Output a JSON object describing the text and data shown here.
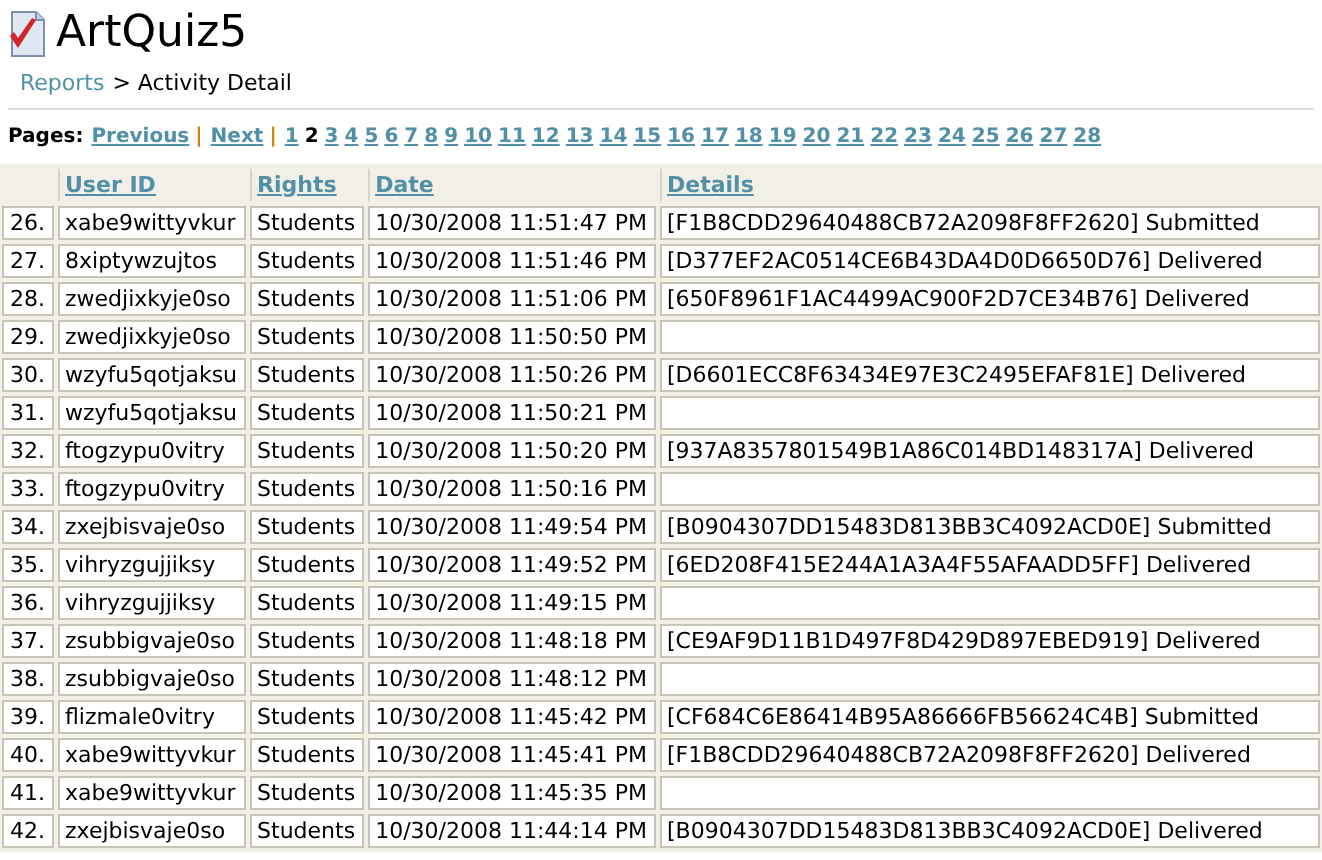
{
  "header": {
    "title": "ArtQuiz5",
    "breadcrumb": {
      "link": "Reports",
      "current": "> Activity Detail"
    }
  },
  "pager": {
    "label": "Pages:",
    "previous": "Previous",
    "next": "Next",
    "separator": "|",
    "pages": [
      {
        "label": "1",
        "selected": false
      },
      {
        "label": "2",
        "selected": true
      },
      {
        "label": "3",
        "selected": false
      },
      {
        "label": "4",
        "selected": false
      },
      {
        "label": "5",
        "selected": false
      },
      {
        "label": "6",
        "selected": false
      },
      {
        "label": "7",
        "selected": false
      },
      {
        "label": "8",
        "selected": false
      },
      {
        "label": "9",
        "selected": false
      },
      {
        "label": "10",
        "selected": false
      },
      {
        "label": "11",
        "selected": false
      },
      {
        "label": "12",
        "selected": false
      },
      {
        "label": "13",
        "selected": false
      },
      {
        "label": "14",
        "selected": false
      },
      {
        "label": "15",
        "selected": false
      },
      {
        "label": "16",
        "selected": false
      },
      {
        "label": "17",
        "selected": false
      },
      {
        "label": "18",
        "selected": false
      },
      {
        "label": "19",
        "selected": false
      },
      {
        "label": "20",
        "selected": false
      },
      {
        "label": "21",
        "selected": false
      },
      {
        "label": "22",
        "selected": false
      },
      {
        "label": "23",
        "selected": false
      },
      {
        "label": "24",
        "selected": false
      },
      {
        "label": "25",
        "selected": false
      },
      {
        "label": "26",
        "selected": false
      },
      {
        "label": "27",
        "selected": false
      },
      {
        "label": "28",
        "selected": false
      }
    ]
  },
  "table": {
    "columns": [
      "User ID",
      "Rights",
      "Date",
      "Details"
    ],
    "rows": [
      {
        "number": "26.",
        "user_id": "xabe9wittyvkur",
        "rights": "Students",
        "date": "10/30/2008 11:51:47 PM",
        "details": "[F1B8CDD29640488CB72A2098F8FF2620] Submitted"
      },
      {
        "number": "27.",
        "user_id": "8xiptywzujtos",
        "rights": "Students",
        "date": "10/30/2008 11:51:46 PM",
        "details": "[D377EF2AC0514CE6B43DA4D0D6650D76] Delivered"
      },
      {
        "number": "28.",
        "user_id": "zwedjixkyje0so",
        "rights": "Students",
        "date": "10/30/2008 11:51:06 PM",
        "details": "[650F8961F1AC4499AC900F2D7CE34B76] Delivered"
      },
      {
        "number": "29.",
        "user_id": "zwedjixkyje0so",
        "rights": "Students",
        "date": "10/30/2008 11:50:50 PM"
      },
      {
        "number": "30.",
        "user_id": "wzyfu5qotjaksu",
        "rights": "Students",
        "date": "10/30/2008 11:50:26 PM",
        "details": "[D6601ECC8F63434E97E3C2495EFAF81E] Delivered"
      },
      {
        "number": "31.",
        "user_id": "wzyfu5qotjaksu",
        "rights": "Students",
        "date": "10/30/2008 11:50:21 PM"
      },
      {
        "number": "32.",
        "user_id": "ftogzypu0vitry",
        "rights": "Students",
        "date": "10/30/2008 11:50:20 PM",
        "details": "[937A8357801549B1A86C014BD148317A] Delivered"
      },
      {
        "number": "33.",
        "user_id": "ftogzypu0vitry",
        "rights": "Students",
        "date": "10/30/2008 11:50:16 PM"
      },
      {
        "number": "34.",
        "user_id": "zxejbisvaje0so",
        "rights": "Students",
        "date": "10/30/2008 11:49:54 PM",
        "details": "[B0904307DD15483D813BB3C4092ACD0E] Submitted"
      },
      {
        "number": "35.",
        "user_id": "vihryzgujjiksy",
        "rights": "Students",
        "date": "10/30/2008 11:49:52 PM",
        "details": "[6ED208F415E244A1A3A4F55AFAADD5FF] Delivered"
      },
      {
        "number": "36.",
        "user_id": "vihryzgujjiksy",
        "rights": "Students",
        "date": "10/30/2008 11:49:15 PM"
      },
      {
        "number": "37.",
        "user_id": "zsubbigvaje0so",
        "rights": "Students",
        "date": "10/30/2008 11:48:18 PM",
        "details": "[CE9AF9D11B1D497F8D429D897EBED919] Delivered"
      },
      {
        "number": "38.",
        "user_id": "zsubbigvaje0so",
        "rights": "Students",
        "date": "10/30/2008 11:48:12 PM"
      },
      {
        "number": "39.",
        "user_id": "flizmale0vitry",
        "rights": "Students",
        "date": "10/30/2008 11:45:42 PM",
        "details": "[CF684C6E86414B95A86666FB56624C4B] Submitted"
      },
      {
        "number": "40.",
        "user_id": "xabe9wittyvkur",
        "rights": "Students",
        "date": "10/30/2008 11:45:41 PM",
        "details": "[F1B8CDD29640488CB72A2098F8FF2620] Delivered"
      },
      {
        "number": "41.",
        "user_id": "xabe9wittyvkur",
        "rights": "Students",
        "date": "10/30/2008 11:45:35 PM"
      },
      {
        "number": "42.",
        "user_id": "zxejbisvaje0so",
        "rights": "Students",
        "date": "10/30/2008 11:44:14 PM",
        "details": "[B0904307DD15483D813BB3C4092ACD0E] Delivered"
      }
    ]
  }
}
